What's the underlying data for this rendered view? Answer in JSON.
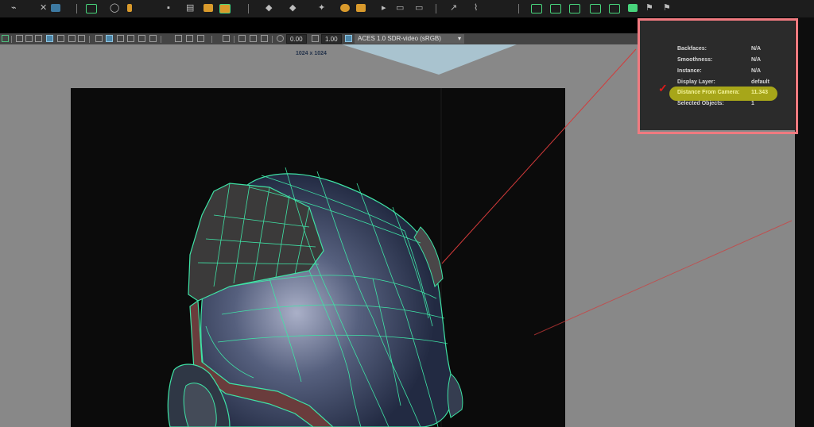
{
  "viewport": {
    "resolution_label": "1024 x 1024",
    "gamma_field": "0.00",
    "exposure_field": "1.00",
    "color_space": "ACES 1.0 SDR-video (sRGB)"
  },
  "hud": {
    "rows": [
      {
        "label": "Backfaces:",
        "value": "N/A"
      },
      {
        "label": "Smoothness:",
        "value": "N/A"
      },
      {
        "label": "Instance:",
        "value": "N/A"
      },
      {
        "label": "Display Layer:",
        "value": "default"
      },
      {
        "label": "Distance From Camera:",
        "value": "11.343"
      },
      {
        "label": "Selected Objects:",
        "value": "1"
      }
    ]
  },
  "colors": {
    "wireframe": "#3fe3a6",
    "annotation_box": "#f07a80",
    "highlight": "#bdbc16",
    "check": "#e01a1a",
    "camera_line": "#d33a3a"
  }
}
